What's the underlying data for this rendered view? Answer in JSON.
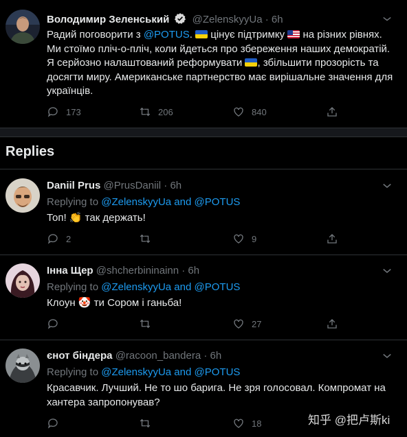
{
  "main_tweet": {
    "name": "Володимир Зеленський",
    "handle": "@ZelenskyyUa",
    "time": "6h",
    "text_parts": [
      "Радий поговорити з ",
      "@POTUS",
      ". ",
      " цінує підтримку ",
      " на різних рівнях. Ми стоїмо пліч-о-пліч, коли йдеться про збереження наших демократій. Я серйозно налаштований реформувати ",
      ", збільшити прозорість та досягти миру. Американське партнерство має вирішальне значення для українців."
    ],
    "replies": "173",
    "retweets": "206",
    "likes": "840"
  },
  "replies_heading": "Replies",
  "replies": [
    {
      "name": "Daniil Prus",
      "handle": "@PrusDaniil",
      "time": "6h",
      "replying_prefix": "Replying to ",
      "replying_to": "@ZelenskyyUa and @POTUS",
      "text_a": "Топ! ",
      "emoji": "👏",
      "text_b": " так держать!",
      "replies": "2",
      "retweets": "",
      "likes": "9"
    },
    {
      "name": "Інна Щер",
      "handle": "@shcherbininainn",
      "time": "6h",
      "replying_prefix": "Replying to ",
      "replying_to": "@ZelenskyyUa and @POTUS",
      "text_a": "Клоун ",
      "emoji": "🤡",
      "text_b": " ти Сором і ганьба!",
      "replies": "",
      "retweets": "",
      "likes": "27"
    },
    {
      "name": "єнот біндера",
      "handle": "@racoon_bandera",
      "time": "6h",
      "replying_prefix": "Replying to ",
      "replying_to": "@ZelenskyyUa and @POTUS",
      "text_a": "Красавчик. Лучший. Не то шо барига. Не зря голосовал. Компромат на хантера запропонував?",
      "emoji": "",
      "text_b": "",
      "replies": "",
      "retweets": "",
      "likes": "18"
    }
  ],
  "watermark": "知乎 @把卢斯ki",
  "colors": {
    "background": "#000000",
    "text": "#e7e9ea",
    "muted": "#71767b",
    "accent": "#1d9bf0",
    "divider": "#2f3336"
  }
}
